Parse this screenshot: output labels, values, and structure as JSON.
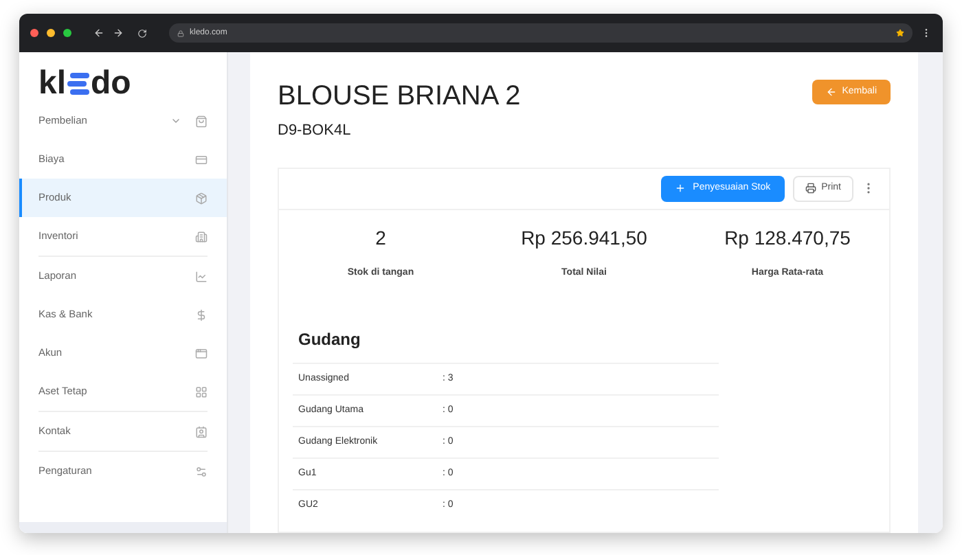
{
  "browser": {
    "url": "kledo.com"
  },
  "logo": {
    "before": "kl",
    "after": "do"
  },
  "sidebar": {
    "groups": [
      [
        {
          "label": "Pembelian",
          "selected": false,
          "expandable": true
        },
        {
          "label": "Biaya",
          "selected": false,
          "expandable": false
        },
        {
          "label": "Produk",
          "selected": true,
          "expandable": false
        },
        {
          "label": "Inventori",
          "selected": false,
          "expandable": false
        }
      ],
      [
        {
          "label": "Laporan",
          "selected": false,
          "expandable": false
        },
        {
          "label": "Kas & Bank",
          "selected": false,
          "expandable": false
        },
        {
          "label": "Akun",
          "selected": false,
          "expandable": false
        },
        {
          "label": "Aset Tetap",
          "selected": false,
          "expandable": false
        }
      ],
      [
        {
          "label": "Kontak",
          "selected": false,
          "expandable": false
        }
      ],
      [
        {
          "label": "Pengaturan",
          "selected": false,
          "expandable": false
        }
      ]
    ]
  },
  "header": {
    "title": "BLOUSE BRIANA 2",
    "code": "D9-BOK4L",
    "back_button": "Kembali"
  },
  "toolbar": {
    "adjust_button": "Penyesuaian Stok",
    "print_button": "Print"
  },
  "stats": [
    {
      "value": "2",
      "label": "Stok di tangan"
    },
    {
      "value": "Rp 256.941,50",
      "label": "Total Nilai"
    },
    {
      "value": "Rp 128.470,75",
      "label": "Harga Rata-rata"
    }
  ],
  "warehouse": {
    "title": "Gudang",
    "rows": [
      {
        "name": "Unassigned",
        "qty": ": 3"
      },
      {
        "name": "Gudang Utama",
        "qty": ": 0"
      },
      {
        "name": "Gudang Elektronik",
        "qty": ": 0"
      },
      {
        "name": "Gu1",
        "qty": ": 0"
      },
      {
        "name": "GU2",
        "qty": ": 0"
      }
    ]
  }
}
